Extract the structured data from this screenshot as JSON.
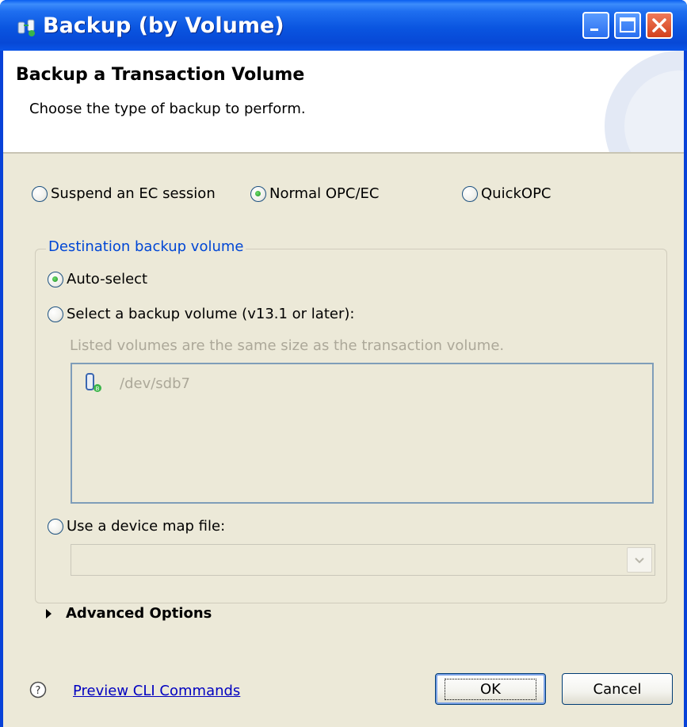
{
  "window": {
    "title": "Backup (by Volume)",
    "controls": [
      "minimize",
      "maximize",
      "close"
    ]
  },
  "header": {
    "title": "Backup a Transaction Volume",
    "description": "Choose the type of backup to perform."
  },
  "backup_type": {
    "options": [
      "Suspend an EC session",
      "Normal OPC/EC",
      "QuickOPC"
    ],
    "selected": "Normal OPC/EC"
  },
  "destination": {
    "group_label": "Destination backup volume",
    "auto_select_label": "Auto-select",
    "select_volume_label": "Select a backup volume (v13.1 or later):",
    "hint": "Listed volumes are the same size as the transaction volume.",
    "volumes": [
      "/dev/sdb7"
    ],
    "device_map_label": "Use a device map file:",
    "device_map_value": "",
    "selected": "Auto-select"
  },
  "advanced": {
    "label": "Advanced Options"
  },
  "footer": {
    "preview_link": "Preview CLI Commands",
    "ok_label": "OK",
    "cancel_label": "Cancel"
  },
  "colors": {
    "titlebar": "#0a55e0",
    "dialog_bg": "#ece9d8",
    "group_label": "#0046d5",
    "link": "#0000c0",
    "disabled_text": "#aca899"
  }
}
